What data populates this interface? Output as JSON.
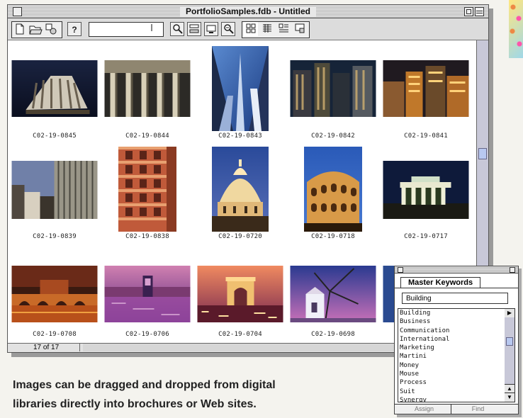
{
  "window": {
    "title": "PortfolioSamples.fdb - Untitled"
  },
  "toolbar": {
    "buttons": [
      "new-document-icon",
      "open-folder-icon",
      "settings-icon",
      "help-icon",
      "find-icon",
      "catalog-icon",
      "gallery-icon",
      "zoom-icon",
      "thumbnail-view-icon",
      "list-view-icon",
      "record-view-icon",
      "slide-show-icon"
    ],
    "help_label": "?",
    "search_value": ""
  },
  "thumbnails": [
    {
      "caption": "C02-19-0845"
    },
    {
      "caption": "C02-19-0844"
    },
    {
      "caption": "C02-19-0843"
    },
    {
      "caption": "C02-19-0842"
    },
    {
      "caption": "C02-19-0841"
    },
    {
      "caption": "C02-19-0839"
    },
    {
      "caption": "C02-19-0838"
    },
    {
      "caption": "C02-19-0720"
    },
    {
      "caption": "C02-19-0718"
    },
    {
      "caption": "C02-19-0717"
    },
    {
      "caption": "C02-19-0708"
    },
    {
      "caption": "C02-19-0706"
    },
    {
      "caption": "C02-19-0704"
    },
    {
      "caption": "C02-19-0698"
    }
  ],
  "status": {
    "count": "17 of 17"
  },
  "keywords": {
    "tab": "Master Keywords",
    "input_value": "Building",
    "items": [
      "Building",
      "Business",
      "Communication",
      "International",
      "Marketing",
      "Martini",
      "Money",
      "Mouse",
      "Process",
      "Suit",
      "Synergy"
    ],
    "assign_label": "Assign",
    "find_label": "Find"
  },
  "caption": {
    "line1": "Images can be dragged and dropped from digital",
    "line2": "libraries directly into brochures or Web sites."
  }
}
